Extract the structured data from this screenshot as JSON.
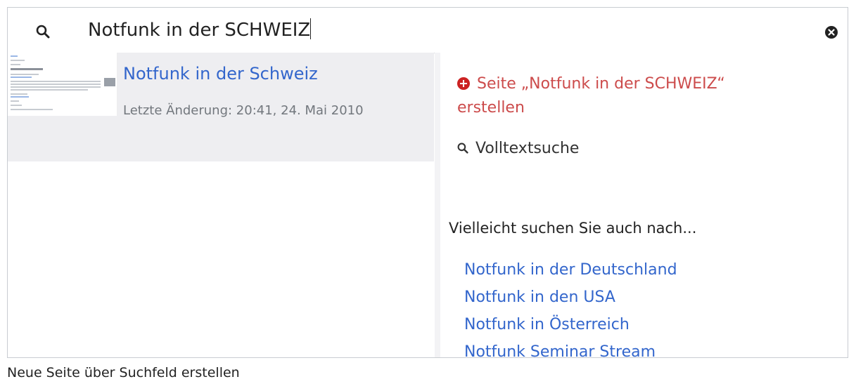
{
  "search": {
    "query": "Notfunk in der SCHWEIZ",
    "search_icon": "search-icon",
    "clear_icon": "clear-icon"
  },
  "results": [
    {
      "title": "Notfunk in der Schweiz",
      "meta": "Letzte Änderung: 20:41, 24. Mai 2010"
    }
  ],
  "actions": {
    "create_page": "Seite „Notfunk in der SCHWEIZ“ erstellen",
    "fulltext": "Volltextsuche"
  },
  "suggestions": {
    "heading": "Vielleicht suchen Sie auch nach...",
    "items": [
      "Notfunk in der Deutschland",
      "Notfunk in den USA",
      "Notfunk in Österreich",
      "Notfunk Seminar Stream"
    ]
  },
  "caption": "Neue Seite über Suchfeld erstellen",
  "colors": {
    "link": "#3366cc",
    "create": "#cc4b4b",
    "result_bg": "#eeeef1"
  }
}
